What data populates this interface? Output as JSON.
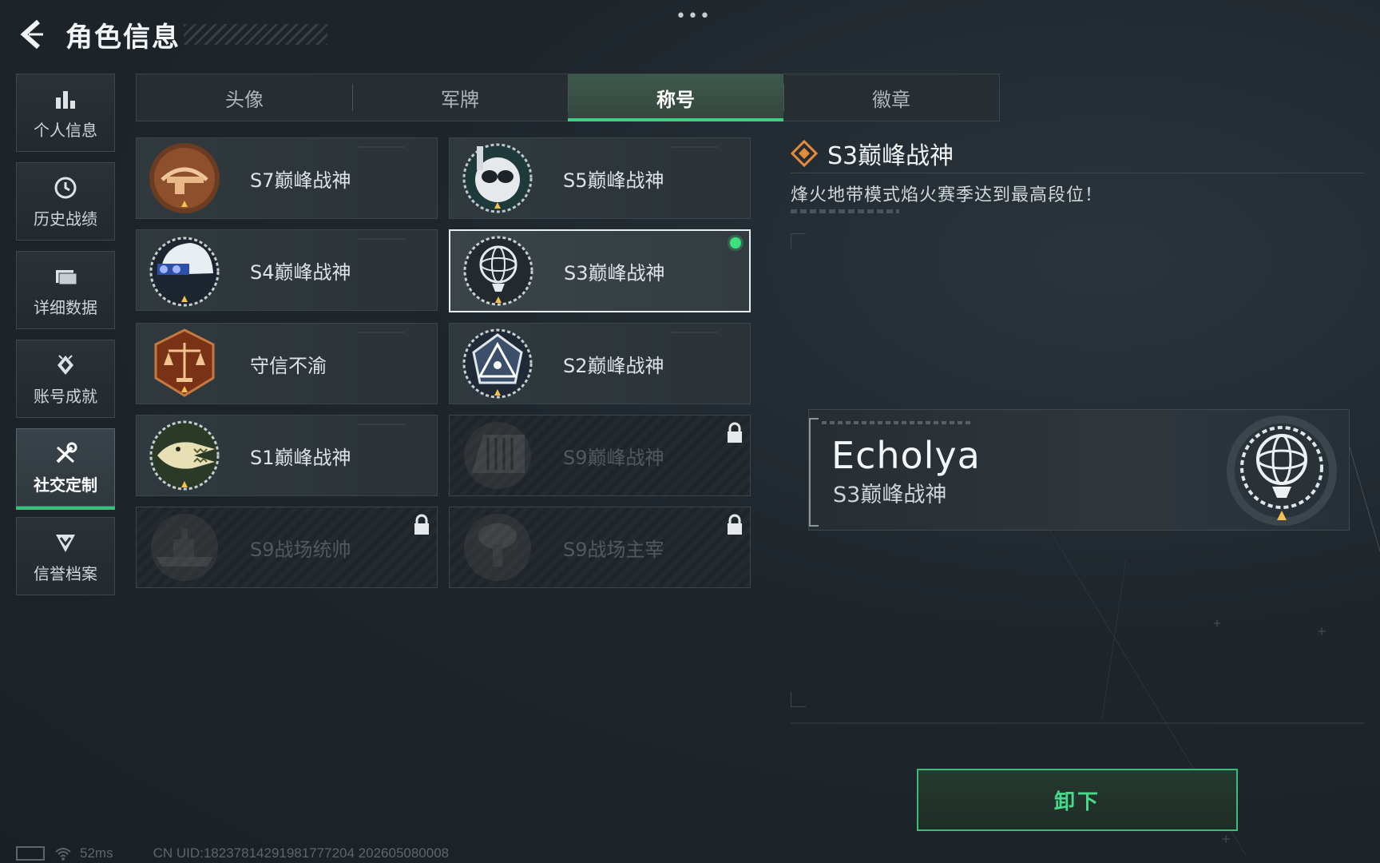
{
  "header": {
    "title": "角色信息",
    "more": "•••"
  },
  "sidebar": {
    "items": [
      {
        "label": "个人信息",
        "icon": "bar-chart-icon"
      },
      {
        "label": "历史战绩",
        "icon": "history-clock-icon"
      },
      {
        "label": "详细数据",
        "icon": "folder-icon"
      },
      {
        "label": "账号成就",
        "icon": "achievement-icon"
      },
      {
        "label": "社交定制",
        "icon": "tools-icon",
        "active": true
      },
      {
        "label": "信誉档案",
        "icon": "shield-chevron-icon"
      }
    ]
  },
  "tabs": [
    {
      "label": "头像"
    },
    {
      "label": "军牌"
    },
    {
      "label": "称号",
      "active": true
    },
    {
      "label": "徽章"
    }
  ],
  "titles": [
    {
      "name": "S7巅峰战神",
      "emblem": "crossbow-emblem-icon",
      "locked": false
    },
    {
      "name": "S5巅峰战神",
      "emblem": "diving-mask-emblem-icon",
      "locked": false
    },
    {
      "name": "S4巅峰战神",
      "emblem": "tactical-helmet-emblem-icon",
      "locked": false
    },
    {
      "name": "S3巅峰战神",
      "emblem": "armillary-sphere-emblem-icon",
      "locked": false,
      "selected": true,
      "equipped": true
    },
    {
      "name": "守信不渝",
      "emblem": "scales-emblem-icon",
      "locked": false
    },
    {
      "name": "S2巅峰战神",
      "emblem": "triangle-eye-emblem-icon",
      "locked": false
    },
    {
      "name": "S1巅峰战神",
      "emblem": "crocodile-emblem-icon",
      "locked": false
    },
    {
      "name": "S9巅峰战神",
      "emblem": "dam-emblem-icon",
      "locked": true
    },
    {
      "name": "S9战场统帅",
      "emblem": "warship-emblem-icon",
      "locked": true
    },
    {
      "name": "S9战场主宰",
      "emblem": "mushroom-cloud-emblem-icon",
      "locked": true
    }
  ],
  "detail": {
    "title": "S3巅峰战神",
    "description": "烽火地带模式焰火赛季达到最高段位！"
  },
  "nameplate": {
    "player_name": "Echolya",
    "title": "S3巅峰战神"
  },
  "actions": {
    "unequip_label": "卸下"
  },
  "status_bar": {
    "ping": "52ms",
    "uid": "CN UID:18237814291981777204  202605080008"
  },
  "colors": {
    "accent_green": "#3dd186",
    "equipped_dot": "#3ee07e",
    "emblem_bronze": "#c87a3e",
    "emblem_silver": "#e4e8ea",
    "detail_diamond": "#e58a3a"
  }
}
